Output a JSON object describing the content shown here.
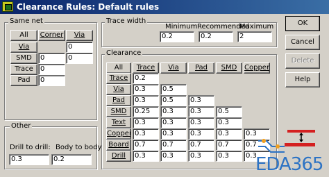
{
  "window": {
    "title": "Clearance Rules: Default rules"
  },
  "same_net": {
    "label": "Same net",
    "header_all": "All",
    "columns": [
      "Corner",
      "Via"
    ],
    "rows": [
      {
        "label": "Via",
        "corner": "",
        "via": "0"
      },
      {
        "label": "SMD",
        "corner": "0",
        "via": "0"
      },
      {
        "label": "Trace",
        "corner": "0"
      },
      {
        "label": "Pad",
        "corner": "0"
      }
    ]
  },
  "trace_width": {
    "label": "Trace width",
    "minimum_label": "Minimum",
    "recommended_label": "Recommended",
    "maximum_label": "Maximum",
    "minimum": "0.2",
    "recommended": "0.2",
    "maximum": "2"
  },
  "clearance": {
    "label": "Clearance",
    "header_all": "All",
    "columns": [
      "Trace",
      "Via",
      "Pad",
      "SMD",
      "Copper"
    ],
    "rows": [
      {
        "label": "Trace",
        "values": [
          "0.2"
        ]
      },
      {
        "label": "Via",
        "values": [
          "0.3",
          "0.5"
        ]
      },
      {
        "label": "Pad",
        "values": [
          "0.3",
          "0.5",
          "0.3"
        ]
      },
      {
        "label": "SMD",
        "values": [
          "0.25",
          "0.3",
          "0.3",
          "0.5"
        ]
      },
      {
        "label": "Text",
        "values": [
          "0.3",
          "0.3",
          "0.3",
          "0.3"
        ]
      },
      {
        "label": "Copper",
        "values": [
          "0.3",
          "0.3",
          "0.3",
          "0.3",
          "0.3"
        ]
      },
      {
        "label": "Board",
        "values": [
          "0.7",
          "0.7",
          "0.7",
          "0.7",
          "0.7"
        ]
      },
      {
        "label": "Drill",
        "values": [
          "0.3",
          "0.3",
          "0.3",
          "0.3",
          "0.3"
        ]
      }
    ]
  },
  "other": {
    "label": "Other",
    "drill_to_drill_label": "Drill to drill:",
    "body_to_body_label": "Body to body:",
    "drill_to_drill": "0.3",
    "body_to_body": "0.2"
  },
  "buttons": {
    "ok": "OK",
    "cancel": "Cancel",
    "delete": "Delete",
    "help": "Help"
  },
  "watermark": {
    "text": "EDA365"
  },
  "colors": {
    "title_start": "#0a246a",
    "title_end": "#3a6ea5",
    "logo_blue": "#2d73c4",
    "diagram_red": "#d42020",
    "diagram_orange": "#f0a020"
  }
}
